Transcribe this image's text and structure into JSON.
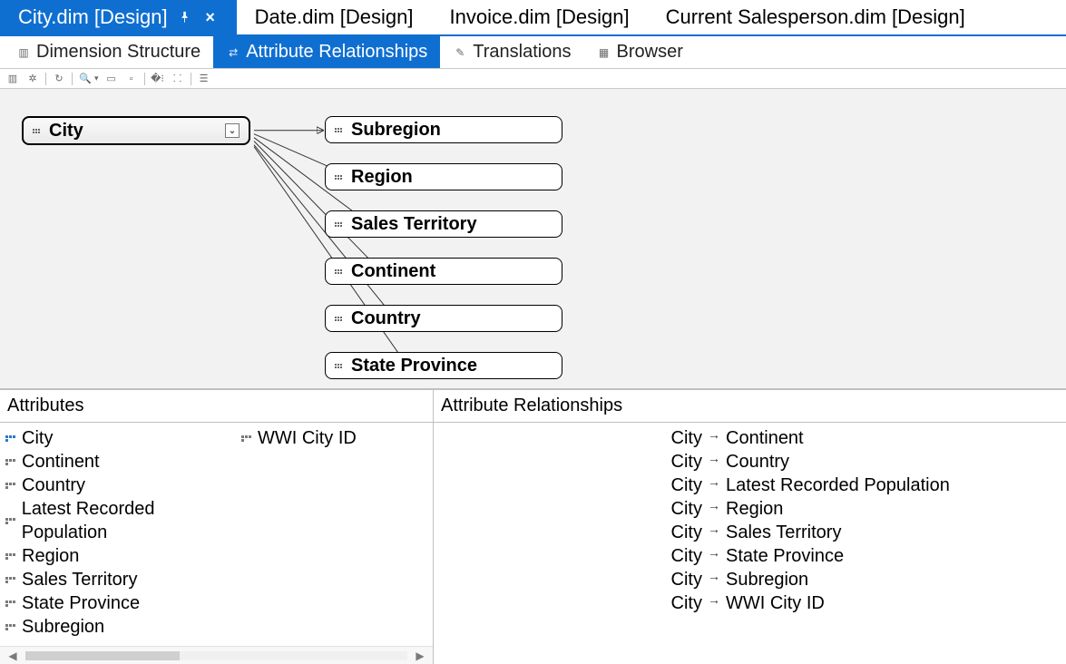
{
  "doc_tabs": [
    {
      "label": "City.dim [Design]",
      "active": true
    },
    {
      "label": "Date.dim [Design]",
      "active": false
    },
    {
      "label": "Invoice.dim [Design]",
      "active": false
    },
    {
      "label": "Current Salesperson.dim [Design]",
      "active": false
    }
  ],
  "designer_tabs": [
    {
      "label": "Dimension Structure",
      "active": false
    },
    {
      "label": "Attribute Relationships",
      "active": true
    },
    {
      "label": "Translations",
      "active": false
    },
    {
      "label": "Browser",
      "active": false
    }
  ],
  "diagram": {
    "root": "City",
    "children": [
      "Subregion",
      "Region",
      "Sales Territory",
      "Continent",
      "Country",
      "State Province"
    ]
  },
  "attributes_panel": {
    "title": "Attributes",
    "col1": [
      {
        "label": "City",
        "key": true
      },
      {
        "label": "Continent"
      },
      {
        "label": "Country"
      },
      {
        "label": "Latest Recorded Population"
      },
      {
        "label": "Region"
      },
      {
        "label": "Sales Territory"
      },
      {
        "label": "State Province"
      },
      {
        "label": "Subregion"
      }
    ],
    "col2": [
      {
        "label": "WWI City ID"
      }
    ]
  },
  "relationships_panel": {
    "title": "Attribute Relationships",
    "rows": [
      {
        "src": "City",
        "dst": "Continent"
      },
      {
        "src": "City",
        "dst": "Country"
      },
      {
        "src": "City",
        "dst": "Latest Recorded Population"
      },
      {
        "src": "City",
        "dst": "Region"
      },
      {
        "src": "City",
        "dst": "Sales Territory"
      },
      {
        "src": "City",
        "dst": "State Province"
      },
      {
        "src": "City",
        "dst": "Subregion"
      },
      {
        "src": "City",
        "dst": "WWI City ID"
      }
    ]
  }
}
